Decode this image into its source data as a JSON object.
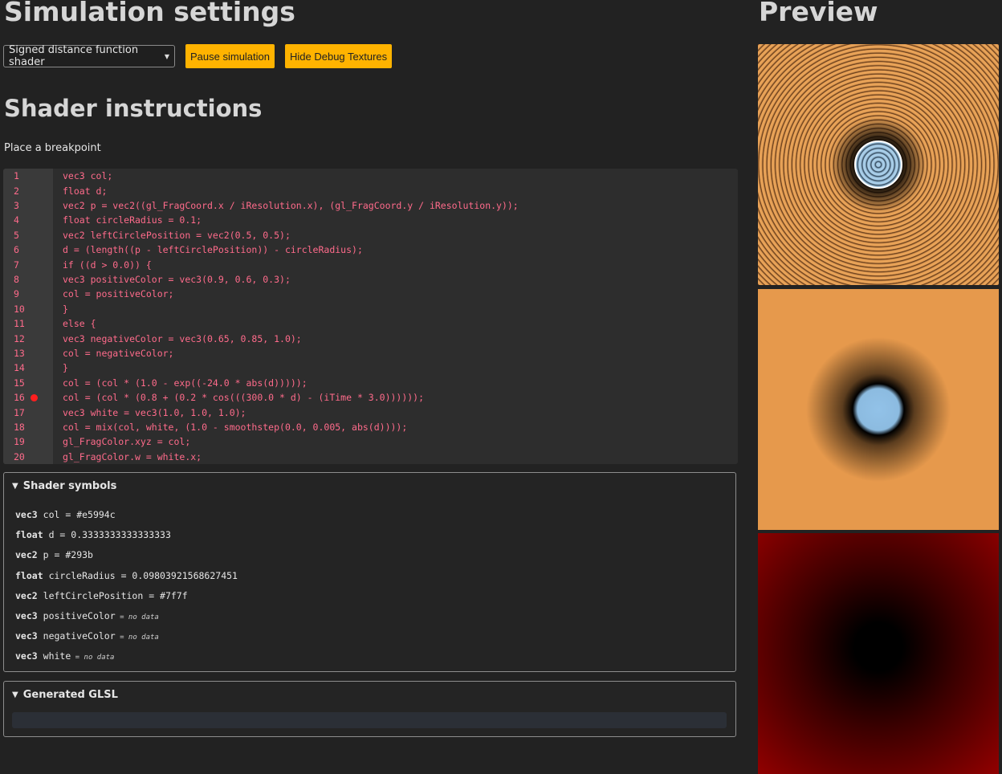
{
  "left": {
    "title": "Simulation settings",
    "toolbar": {
      "shader_select": "Signed distance function shader",
      "pause_label": "Pause simulation",
      "debug_label": "Hide Debug Textures"
    },
    "section_title": "Shader instructions",
    "hint": "Place a breakpoint",
    "code_lines": [
      {
        "n": "1",
        "text": "vec3 col;"
      },
      {
        "n": "2",
        "text": "float d;"
      },
      {
        "n": "3",
        "text": "vec2 p = vec2((gl_FragCoord.x / iResolution.x), (gl_FragCoord.y / iResolution.y));"
      },
      {
        "n": "4",
        "text": "float circleRadius = 0.1;"
      },
      {
        "n": "5",
        "text": "vec2 leftCirclePosition = vec2(0.5, 0.5);"
      },
      {
        "n": "6",
        "text": "d = (length((p - leftCirclePosition)) - circleRadius);"
      },
      {
        "n": "7",
        "text": "if ((d > 0.0)) {"
      },
      {
        "n": "8",
        "text": "vec3 positiveColor = vec3(0.9, 0.6, 0.3);"
      },
      {
        "n": "9",
        "text": "col = positiveColor;"
      },
      {
        "n": "10",
        "text": "}"
      },
      {
        "n": "11",
        "text": "else {"
      },
      {
        "n": "12",
        "text": "vec3 negativeColor = vec3(0.65, 0.85, 1.0);"
      },
      {
        "n": "13",
        "text": "col = negativeColor;"
      },
      {
        "n": "14",
        "text": "}"
      },
      {
        "n": "15",
        "text": "col = (col * (1.0 - exp((-24.0 * abs(d)))));"
      },
      {
        "n": "16",
        "text": "col = (col * (0.8 + (0.2 * cos(((300.0 * d) - (iTime * 3.0))))));"
      },
      {
        "n": "17",
        "text": "vec3 white = vec3(1.0, 1.0, 1.0);"
      },
      {
        "n": "18",
        "text": "col = mix(col, white, (1.0 - smoothstep(0.0, 0.005, abs(d))));"
      },
      {
        "n": "19",
        "text": "gl_FragColor.xyz = col;"
      },
      {
        "n": "20",
        "text": "gl_FragColor.w = white.x;"
      }
    ],
    "breakpoint_line": "16",
    "symbols_panel": {
      "title": "Shader symbols",
      "items": [
        {
          "type": "vec3",
          "name": "col",
          "value": " = #e5994c",
          "no_data": ""
        },
        {
          "type": "float",
          "name": "d",
          "value": " = 0.3333333333333333",
          "no_data": ""
        },
        {
          "type": "vec2",
          "name": "p",
          "value": " = #293b",
          "no_data": ""
        },
        {
          "type": "float",
          "name": "circleRadius",
          "value": " = 0.09803921568627451",
          "no_data": ""
        },
        {
          "type": "vec2",
          "name": "leftCirclePosition",
          "value": " = #7f7f",
          "no_data": ""
        },
        {
          "type": "vec3",
          "name": "positiveColor",
          "value": "",
          "no_data": " = no data"
        },
        {
          "type": "vec3",
          "name": "negativeColor",
          "value": "",
          "no_data": " = no data"
        },
        {
          "type": "vec3",
          "name": "white",
          "value": "",
          "no_data": " = no data"
        }
      ]
    },
    "glsl_panel": {
      "title": "Generated GLSL"
    }
  },
  "right": {
    "title": "Preview"
  },
  "colors": {
    "background": "#222222",
    "accent": "#ffb300",
    "code_text": "#ff6b8b",
    "breakpoint": "#ff1e1e"
  }
}
